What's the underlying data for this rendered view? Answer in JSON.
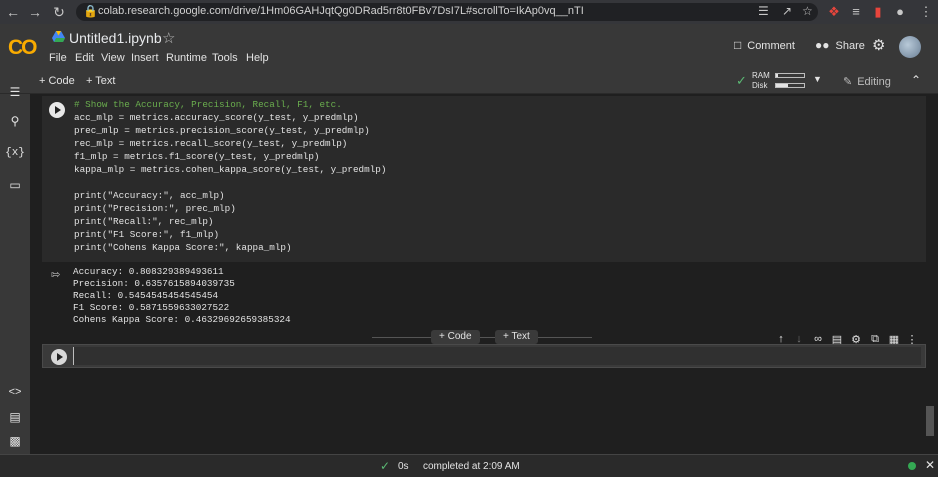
{
  "browser": {
    "url": "colab.research.google.com/drive/1Hm06GAHJqtQg0DRad5rr8t0FBv7DsI7L#scrollTo=IkAp0vq__nTI"
  },
  "header": {
    "logo": "CO",
    "title": "Untitled1.ipynb",
    "menu": [
      "File",
      "Edit",
      "View",
      "Insert",
      "Runtime",
      "Tools",
      "Help"
    ],
    "comment_label": "Comment",
    "share_label": "Share"
  },
  "toolbar": {
    "add_code": "+ Code",
    "add_text": "+ Text",
    "ram_label": "RAM",
    "disk_label": "Disk",
    "ram_level": 0.08,
    "disk_level": 0.42,
    "editing_label": "Editing"
  },
  "cell": {
    "code_lines": [
      "# Show the Accuracy, Precision, Recall, F1, etc.",
      "acc_mlp = metrics.accuracy_score(y_test, y_predmlp)",
      "prec_mlp = metrics.precision_score(y_test, y_predmlp)",
      "rec_mlp = metrics.recall_score(y_test, y_predmlp)",
      "f1_mlp = metrics.f1_score(y_test, y_predmlp)",
      "kappa_mlp = metrics.cohen_kappa_score(y_test, y_predmlp)",
      "",
      "print(\"Accuracy:\", acc_mlp)",
      "print(\"Precision:\", prec_mlp)",
      "print(\"Recall:\", rec_mlp)",
      "print(\"F1 Score:\", f1_mlp)",
      "print(\"Cohens Kappa Score:\", kappa_mlp)"
    ],
    "output_lines": [
      "Accuracy: 0.808329389493611",
      "Precision: 0.6357615894039735",
      "Recall: 0.5454545454545454",
      "F1 Score: 0.5871559633027522",
      "Cohens Kappa Score: 0.46329692659385324"
    ]
  },
  "insert_bar": {
    "code": "+ Code",
    "text": "+ Text"
  },
  "status": {
    "time": "0s",
    "message": "completed at 2:09 AM"
  },
  "colors": {
    "accent_green": "#5bb974",
    "logo_orange": "#f9ab00"
  }
}
